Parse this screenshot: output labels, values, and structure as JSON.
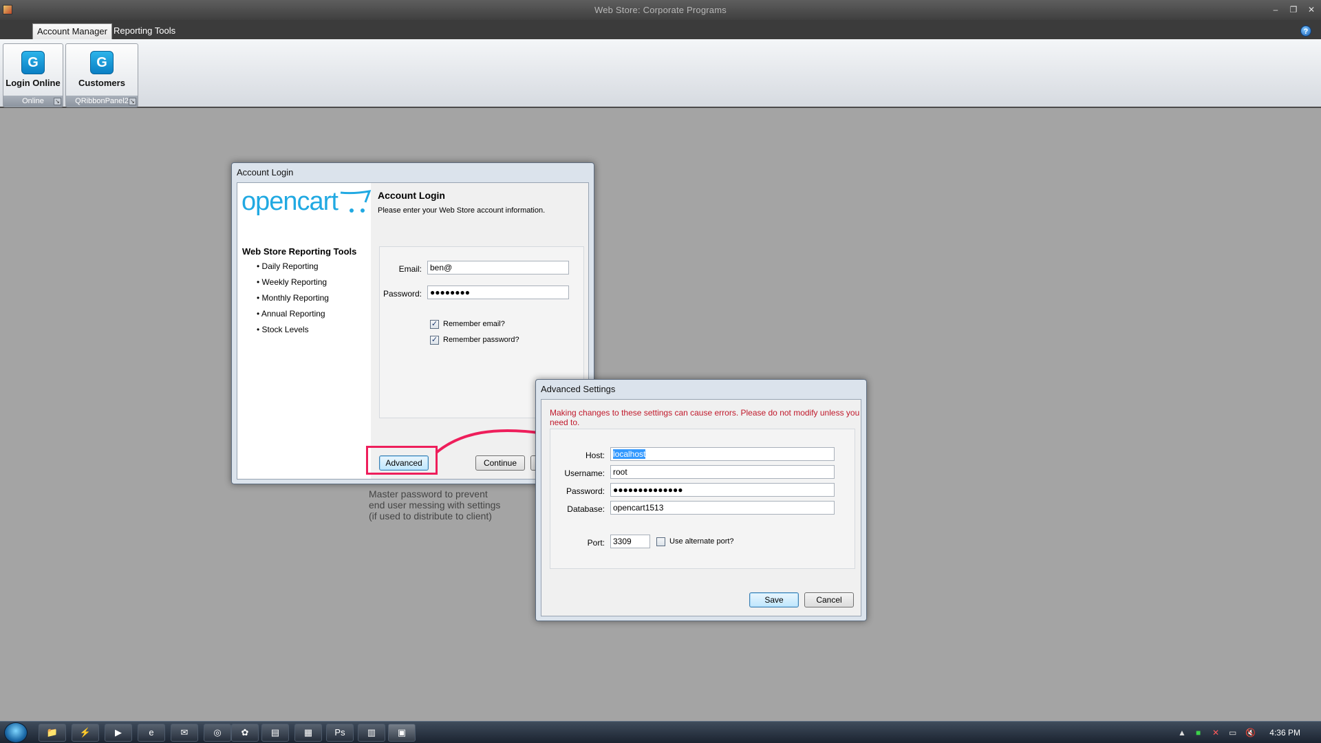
{
  "window": {
    "title": "Web Store: Corporate Programs",
    "minimize": "–",
    "maximize": "❐",
    "close": "✕"
  },
  "menu": {
    "tabs": [
      "Account Manager",
      "Reporting Tools"
    ],
    "help": "?"
  },
  "ribbon": {
    "panels": [
      {
        "button": "Login Online",
        "footer": "Online"
      },
      {
        "button": "Customers",
        "footer": "QRibbonPanel2"
      }
    ],
    "launcher": "↘"
  },
  "login_dialog": {
    "window_title": "Account Login",
    "logo": "opencart",
    "left_title": "Web Store Reporting Tools",
    "left_items": [
      "Daily Reporting",
      "Weekly Reporting",
      "Monthly Reporting",
      "Annual Reporting",
      "Stock Levels"
    ],
    "heading": "Account Login",
    "subheading": "Please enter your Web Store account information.",
    "email_label": "Email:",
    "email_value": "ben@",
    "password_label": "Password:",
    "password_value": "●●●●●●●●",
    "remember_email": "Remember email?",
    "remember_password": "Remember password?",
    "check_mark": "✓",
    "advanced_button": "Advanced",
    "continue_button": "Continue"
  },
  "annotation": {
    "note": [
      "Master password to prevent",
      "end user messing with settings",
      "(if used to distribute to client)"
    ],
    "colors": {
      "highlight": "#ee1e5b"
    }
  },
  "advanced_dialog": {
    "window_title": "Advanced Settings",
    "warning": "Making changes to these settings can cause errors. Please do not modify unless you need to.",
    "host_label": "Host:",
    "host_value": "localhost",
    "username_label": "Username:",
    "username_value": "root",
    "password_label": "Password:",
    "password_value": "●●●●●●●●●●●●●●",
    "database_label": "Database:",
    "database_value": "opencart1513",
    "port_label": "Port:",
    "port_value": "3309",
    "alt_port": "Use alternate port?",
    "save_button": "Save",
    "cancel_button": "Cancel"
  },
  "taskbar": {
    "items": [
      "📁",
      "⚡",
      "▶",
      "e",
      "✉",
      "◎",
      "✿",
      "▤",
      "▦",
      "Ps",
      "▥",
      "▣"
    ],
    "clock": "4:36 PM",
    "tray": [
      "▲",
      "■",
      "✕",
      "▭",
      "🔇"
    ]
  }
}
